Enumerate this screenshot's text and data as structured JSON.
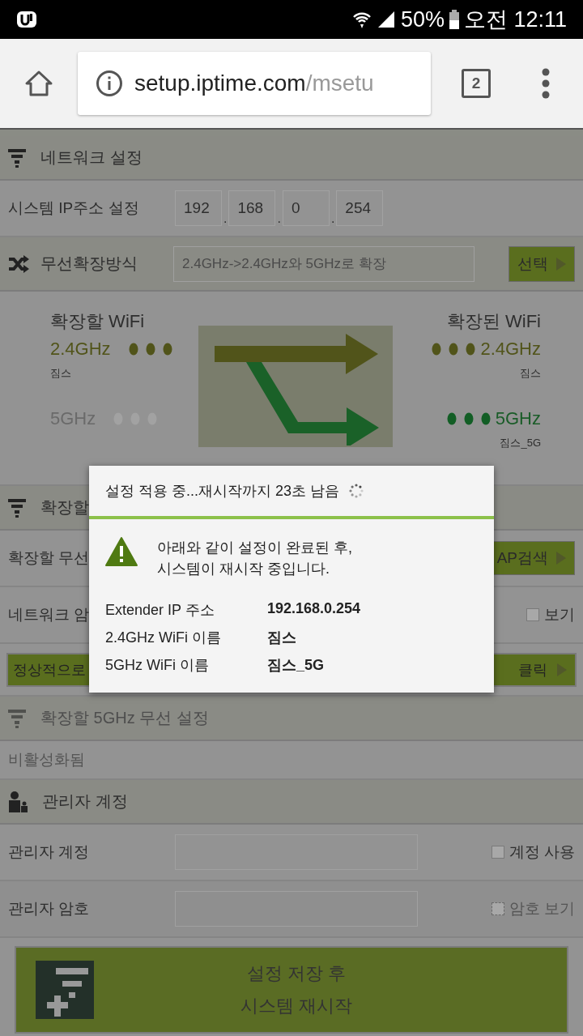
{
  "status_bar": {
    "battery": "50%",
    "time": "오전 12:11"
  },
  "browser": {
    "url_host": "setup.iptime.com",
    "url_path": "/msetu",
    "tab_count": "2"
  },
  "network": {
    "title": "네트워크 설정",
    "ip_label": "시스템 IP주소 설정",
    "ip_octets": [
      "192",
      "168",
      "0",
      "254"
    ],
    "ip_separator": "."
  },
  "mode": {
    "title": "무선확장방식",
    "value": "2.4GHz->2.4GHz와 5GHz로 확장",
    "button": "선택"
  },
  "diagram": {
    "source_title": "확장할 WiFi",
    "target_title": "확장된 WiFi",
    "source": [
      {
        "band": "2.4GHz",
        "name": "짐스",
        "active": true
      },
      {
        "band": "5GHz",
        "active": false
      }
    ],
    "target": [
      {
        "band": "2.4GHz",
        "name": "짐스",
        "active": true
      },
      {
        "band": "5GHz",
        "name": "짐스_5G",
        "active": true
      }
    ]
  },
  "ext_24": {
    "title": "확장할",
    "rows": [
      {
        "kind": "button",
        "label": "확장할 무선",
        "button": "AP검색"
      },
      {
        "kind": "checkbox",
        "label": "네트워크 암",
        "option": "보기",
        "checked": false
      },
      {
        "kind": "banner",
        "label": "정상적으로",
        "button": "클릭"
      }
    ]
  },
  "ext_5": {
    "title": "확장할 5GHz 무선 설정",
    "disabled": true,
    "status": "비활성화됨"
  },
  "admin": {
    "title": "관리자 계정",
    "rows": [
      {
        "label": "관리자 계정",
        "option": "계정 사용",
        "checked": false,
        "disabled": false
      },
      {
        "label": "관리자 암호",
        "option": "암호 보기",
        "checked": false,
        "disabled": true
      }
    ]
  },
  "save_button": {
    "lines": [
      "설정 저장 후",
      "시스템 재시작"
    ]
  },
  "dialog": {
    "title": "설정 적용 중...재시작까지 23초 남음",
    "message": "아래와 같이 설정이 완료된 후,\n시스템이 재시작 중입니다.",
    "details": [
      {
        "label": "Extender IP 주소",
        "value": "192.168.0.254"
      },
      {
        "label": "2.4GHz WiFi 이름",
        "value": "짐스"
      },
      {
        "label": "5GHz WiFi 이름",
        "value": "짐스_5G"
      }
    ]
  }
}
